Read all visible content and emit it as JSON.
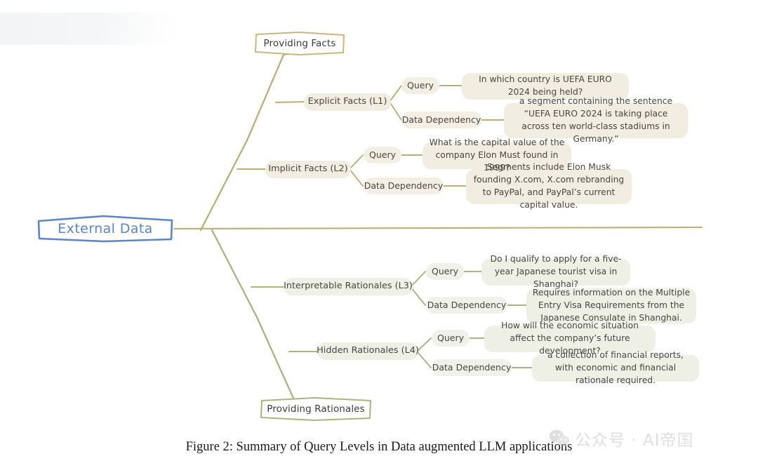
{
  "figure": {
    "caption": "Figure 2: Summary of Query Levels in Data augmented LLM applications",
    "root": {
      "label": "External Data",
      "color": "#5b85c6"
    },
    "top_cap": {
      "label": "Providing Facts",
      "color": "#c9b77e"
    },
    "bottom_cap": {
      "label": "Providing Rationales",
      "color": "#a9b482"
    },
    "palette": {
      "tan_line": "#bdae77",
      "olive_line": "#a9b482",
      "tan_fill": "#f2ede1",
      "olive_fill": "#eef0e6",
      "root_stroke": "#5b85c6",
      "text": "#3a3a3a"
    },
    "branches": [
      {
        "id": "l1",
        "level_label": "Explicit Facts (L1)",
        "tone": "tan",
        "items": [
          {
            "kind": "Query",
            "text": "In which country is UEFA EURO 2024 being held?"
          },
          {
            "kind": "Data Dependency",
            "text": "a segment containing the sentence “UEFA EURO 2024 is taking place across ten world-class stadiums in Germany.”"
          }
        ]
      },
      {
        "id": "l2",
        "level_label": "Implicit Facts (L2)",
        "tone": "tan",
        "items": [
          {
            "kind": "Query",
            "text": "What is the capital value of the company Elon Must found in 1999?"
          },
          {
            "kind": "Data Dependency",
            "text": "Segments include Elon Musk founding X.com, X.com rebranding to PayPal, and PayPal’s current capital value."
          }
        ]
      },
      {
        "id": "l3",
        "level_label": "Interpretable Rationales (L3)",
        "tone": "olive",
        "items": [
          {
            "kind": "Query",
            "text": "Do I qualify to apply for a five-year Japanese tourist visa in Shanghai?"
          },
          {
            "kind": "Data Dependency",
            "text": "Requires information on the Multiple Entry Visa Requirements from the Japanese Consulate in Shanghai."
          }
        ]
      },
      {
        "id": "l4",
        "level_label": "Hidden Rationales (L4)",
        "tone": "olive",
        "items": [
          {
            "kind": "Query",
            "text": "How will the economic situation affect the company’s future development?"
          },
          {
            "kind": "Data Dependency",
            "text": "a collection of financial reports, with economic and financial rationale required."
          }
        ]
      }
    ]
  },
  "watermark": {
    "text": "公众号 · AI帝国",
    "icon": "wechat-icon"
  }
}
